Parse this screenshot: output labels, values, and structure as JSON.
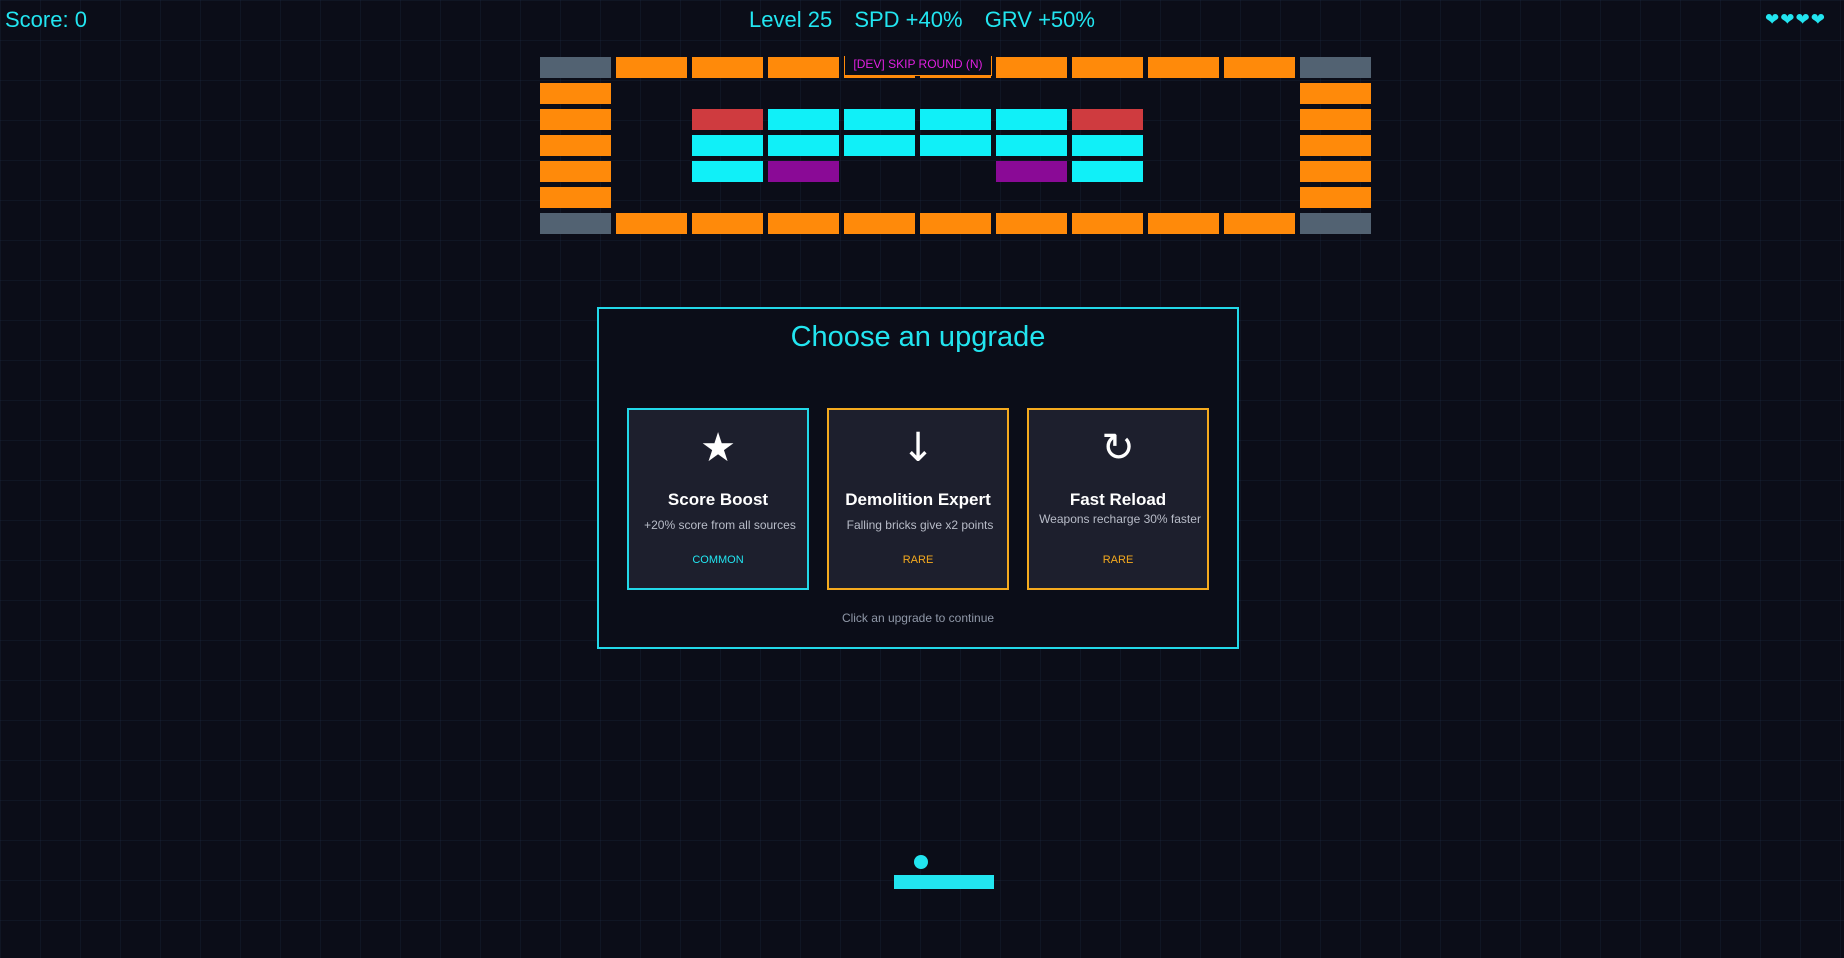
{
  "hud": {
    "score": "Score: 0",
    "level": "Level 25",
    "speed": "SPD +40%",
    "gravity": "GRV +50%",
    "lives": "❤❤❤❤"
  },
  "dev_button": "[DEV] SKIP ROUND (N)",
  "upgrade": {
    "title": "Choose an upgrade",
    "hint": "Click an upgrade to continue",
    "cards": [
      {
        "icon": "★",
        "icon_name": "star-icon",
        "name": "Score Boost",
        "description": "+20% score from all sources",
        "rarity": "COMMON"
      },
      {
        "icon": "↓",
        "icon_name": "down-arrow-icon",
        "name": "Demolition Expert",
        "description": "Falling bricks give x2 points",
        "rarity": "RARE"
      },
      {
        "icon": "↻",
        "icon_name": "reload-icon",
        "name": "Fast Reload",
        "description": "Weapons recharge 30% faster",
        "rarity": "RARE"
      }
    ]
  },
  "colors": {
    "accent": "#22e5f0",
    "orange": "#ff8a0a",
    "gray": "#526272",
    "red": "#cf3b3f",
    "cyan": "#10f0f8",
    "purple": "#8a0a96",
    "dev_text": "#e020e0",
    "rare": "#f5aa1e"
  },
  "bricks": {
    "legend": {
      "O": "orange",
      "G": "gray",
      "R": "red",
      "C": "cyan",
      "P": "purple",
      ".": "empty"
    },
    "rows": [
      "GOOOOOOOOOG",
      "O.........O",
      "O.RCCCCR..O",
      "O.CCCCCC..O",
      "O.CP..PC..O",
      "O.........O",
      "GOOOOOOOOOG"
    ]
  }
}
